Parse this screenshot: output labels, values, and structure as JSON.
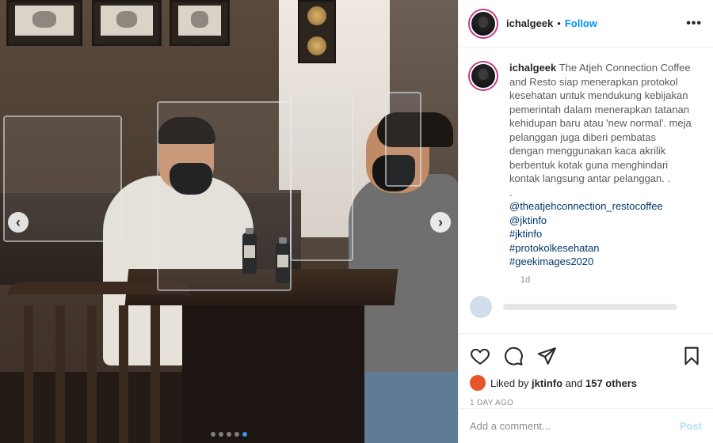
{
  "post": {
    "username": "ichalgeek",
    "follow_label": "Follow",
    "separator": "•",
    "more_label": "•••"
  },
  "caption": {
    "username": "ichalgeek",
    "text": "The Atjeh Connection Coffee and Resto siap menerapkan protokol kesehatan untuk mendukung kebijakan pemerintah dalam menerapkan tatanan kehidupan baru atau 'new normal'. meja pelanggan juga diberi pembatas dengan menggunakan kaca akrilik berbentuk kotak guna menghindari kontak langsung antar pelanggan. .",
    "dot": ".",
    "tags": [
      "@theatjehconnection_restocoffee",
      "@jktinfo",
      "#jktinfo",
      "#protokolkesehatan",
      "#geekimages2020"
    ],
    "time": "1d"
  },
  "likes": {
    "prefix": "Liked by",
    "user": "jktinfo",
    "middle": "and",
    "others": "157 others"
  },
  "date_label": "1 DAY AGO",
  "comment_box": {
    "placeholder": "Add a comment...",
    "post_label": "Post"
  },
  "carousel": {
    "prev_glyph": "‹",
    "next_glyph": "›",
    "total_slides": 5,
    "active_slide": 5
  },
  "icons": [
    "heart-icon",
    "comment-icon",
    "share-icon",
    "bookmark-icon",
    "chevron-left-icon",
    "chevron-right-icon"
  ],
  "colors": {
    "link": "#00376b",
    "follow": "#0095f6",
    "post_disabled": "#b2dffc",
    "muted": "#8e8e8e"
  }
}
